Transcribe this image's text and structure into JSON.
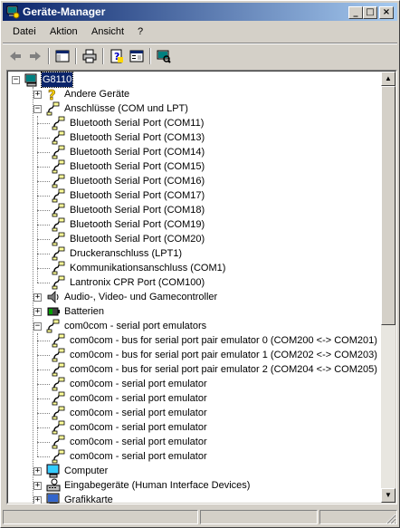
{
  "window": {
    "title": "Geräte-Manager"
  },
  "titlebar_buttons": {
    "minimize": "_",
    "maximize": "□",
    "close": "×"
  },
  "menu": [
    {
      "label": "Datei"
    },
    {
      "label": "Aktion"
    },
    {
      "label": "Ansicht"
    },
    {
      "label": "?"
    }
  ],
  "toolbar": [
    {
      "icon": "back-arrow-icon"
    },
    {
      "icon": "forward-arrow-icon"
    },
    {
      "icon": "show-hide-console-tree-icon"
    },
    {
      "icon": "print-icon"
    },
    {
      "icon": "help-icon"
    },
    {
      "icon": "properties-icon"
    },
    {
      "icon": "scan-hardware-icon"
    }
  ],
  "tree": {
    "root": "G8110",
    "categories": [
      {
        "label": "Andere Geräte",
        "icon": "question-icon",
        "expanded": false,
        "children": []
      },
      {
        "label": "Anschlüsse (COM und LPT)",
        "icon": "port-icon",
        "expanded": true,
        "children": [
          "Bluetooth Serial Port (COM11)",
          "Bluetooth Serial Port (COM13)",
          "Bluetooth Serial Port (COM14)",
          "Bluetooth Serial Port (COM15)",
          "Bluetooth Serial Port (COM16)",
          "Bluetooth Serial Port (COM17)",
          "Bluetooth Serial Port (COM18)",
          "Bluetooth Serial Port (COM19)",
          "Bluetooth Serial Port (COM20)",
          "Druckeranschluss (LPT1)",
          "Kommunikationsanschluss (COM1)",
          "Lantronix CPR Port (COM100)"
        ]
      },
      {
        "label": "Audio-, Video- und Gamecontroller",
        "icon": "audio-icon",
        "expanded": false,
        "children": []
      },
      {
        "label": "Batterien",
        "icon": "battery-icon",
        "expanded": false,
        "children": []
      },
      {
        "label": "com0com - serial port emulators",
        "icon": "port-icon",
        "expanded": true,
        "children": [
          "com0com - bus for serial port pair emulator 0 (COM200 <-> COM201)",
          "com0com - bus for serial port pair emulator 1 (COM202 <-> COM203)",
          "com0com - bus for serial port pair emulator 2 (COM204 <-> COM205)",
          "com0com - serial port emulator",
          "com0com - serial port emulator",
          "com0com - serial port emulator",
          "com0com - serial port emulator",
          "com0com - serial port emulator",
          "com0com - serial port emulator"
        ]
      },
      {
        "label": "Computer",
        "icon": "computer-icon",
        "expanded": false,
        "children": []
      },
      {
        "label": "Eingabegeräte (Human Interface Devices)",
        "icon": "hid-icon",
        "expanded": false,
        "children": []
      },
      {
        "label": "Grafikkarte",
        "icon": "display-adapter-icon",
        "expanded": false,
        "children": []
      }
    ]
  },
  "colors": {
    "titlebar_start": "#0a246a",
    "titlebar_end": "#a6caf0",
    "selection": "#0a246a",
    "face": "#d4d0c8"
  }
}
